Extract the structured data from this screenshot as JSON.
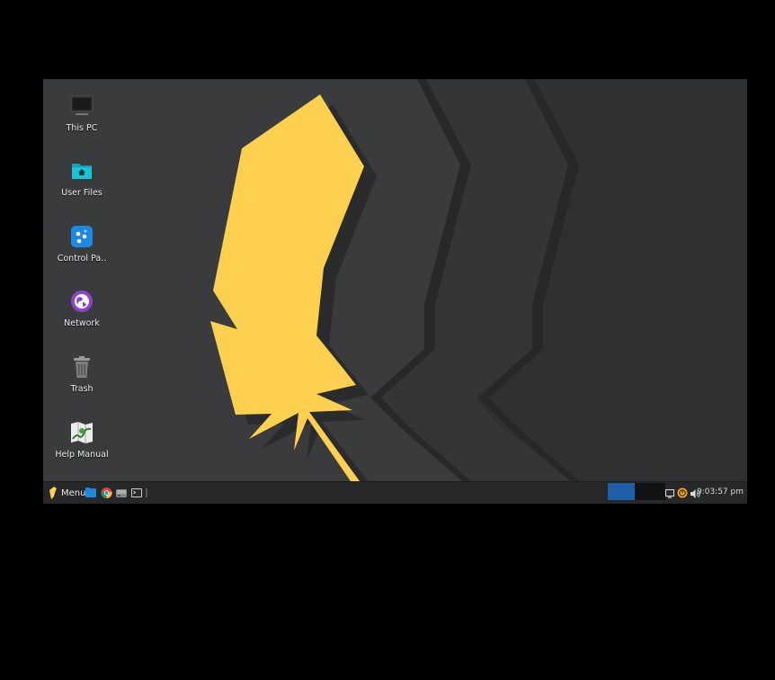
{
  "desktop": {
    "icons": [
      {
        "label": "This PC",
        "icon": "computer-icon"
      },
      {
        "label": "User Files",
        "icon": "home-folder-icon"
      },
      {
        "label": "Control Pa..",
        "icon": "control-panel-icon"
      },
      {
        "label": "Network",
        "icon": "network-globe-icon"
      },
      {
        "label": "Trash",
        "icon": "trash-icon"
      },
      {
        "label": "Help Manual",
        "icon": "help-manual-icon"
      }
    ]
  },
  "taskbar": {
    "menu_label": "Menu",
    "launchers": [
      "file-manager-icon",
      "chrome-icon",
      "drive-icon",
      "terminal-icon"
    ],
    "workspaces": 2,
    "active_workspace": 1,
    "tray": [
      "display-icon",
      "update-icon",
      "volume-icon"
    ],
    "clock": "9:03:57 pm"
  },
  "colors": {
    "feather": "#fdd14f",
    "wallpaper_bg": "#3a3b3c",
    "taskbar_bg": "#262829",
    "workspace_active": "#1f5ea8"
  }
}
